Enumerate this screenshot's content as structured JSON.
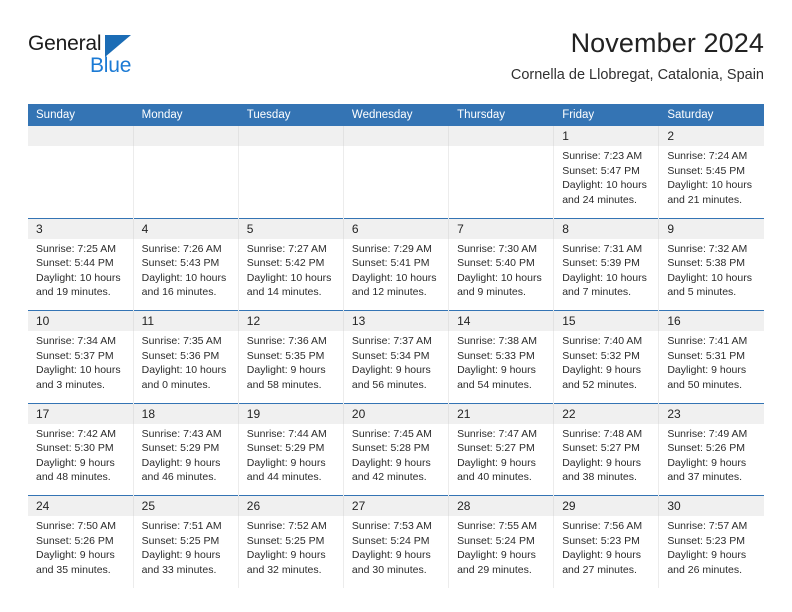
{
  "brand": {
    "name_part1": "General",
    "name_part2": "Blue",
    "accent_color": "#1B7AD4",
    "triangle_color": "#1B6CB5"
  },
  "header": {
    "title": "November 2024",
    "subtitle": "Cornella de Llobregat, Catalonia, Spain",
    "header_bg": "#3474B4"
  },
  "weekdays": [
    "Sunday",
    "Monday",
    "Tuesday",
    "Wednesday",
    "Thursday",
    "Friday",
    "Saturday"
  ],
  "labels": {
    "sunrise_prefix": "Sunrise: ",
    "sunset_prefix": "Sunset: ",
    "daylight_prefix": "Daylight: "
  },
  "weeks": [
    [
      {
        "day": "",
        "empty": true
      },
      {
        "day": "",
        "empty": true
      },
      {
        "day": "",
        "empty": true
      },
      {
        "day": "",
        "empty": true
      },
      {
        "day": "",
        "empty": true
      },
      {
        "day": "1",
        "sunrise": "Sunrise: 7:23 AM",
        "sunset": "Sunset: 5:47 PM",
        "daylight_l1": "Daylight: 10 hours",
        "daylight_l2": "and 24 minutes."
      },
      {
        "day": "2",
        "sunrise": "Sunrise: 7:24 AM",
        "sunset": "Sunset: 5:45 PM",
        "daylight_l1": "Daylight: 10 hours",
        "daylight_l2": "and 21 minutes."
      }
    ],
    [
      {
        "day": "3",
        "sunrise": "Sunrise: 7:25 AM",
        "sunset": "Sunset: 5:44 PM",
        "daylight_l1": "Daylight: 10 hours",
        "daylight_l2": "and 19 minutes."
      },
      {
        "day": "4",
        "sunrise": "Sunrise: 7:26 AM",
        "sunset": "Sunset: 5:43 PM",
        "daylight_l1": "Daylight: 10 hours",
        "daylight_l2": "and 16 minutes."
      },
      {
        "day": "5",
        "sunrise": "Sunrise: 7:27 AM",
        "sunset": "Sunset: 5:42 PM",
        "daylight_l1": "Daylight: 10 hours",
        "daylight_l2": "and 14 minutes."
      },
      {
        "day": "6",
        "sunrise": "Sunrise: 7:29 AM",
        "sunset": "Sunset: 5:41 PM",
        "daylight_l1": "Daylight: 10 hours",
        "daylight_l2": "and 12 minutes."
      },
      {
        "day": "7",
        "sunrise": "Sunrise: 7:30 AM",
        "sunset": "Sunset: 5:40 PM",
        "daylight_l1": "Daylight: 10 hours",
        "daylight_l2": "and 9 minutes."
      },
      {
        "day": "8",
        "sunrise": "Sunrise: 7:31 AM",
        "sunset": "Sunset: 5:39 PM",
        "daylight_l1": "Daylight: 10 hours",
        "daylight_l2": "and 7 minutes."
      },
      {
        "day": "9",
        "sunrise": "Sunrise: 7:32 AM",
        "sunset": "Sunset: 5:38 PM",
        "daylight_l1": "Daylight: 10 hours",
        "daylight_l2": "and 5 minutes."
      }
    ],
    [
      {
        "day": "10",
        "sunrise": "Sunrise: 7:34 AM",
        "sunset": "Sunset: 5:37 PM",
        "daylight_l1": "Daylight: 10 hours",
        "daylight_l2": "and 3 minutes."
      },
      {
        "day": "11",
        "sunrise": "Sunrise: 7:35 AM",
        "sunset": "Sunset: 5:36 PM",
        "daylight_l1": "Daylight: 10 hours",
        "daylight_l2": "and 0 minutes."
      },
      {
        "day": "12",
        "sunrise": "Sunrise: 7:36 AM",
        "sunset": "Sunset: 5:35 PM",
        "daylight_l1": "Daylight: 9 hours",
        "daylight_l2": "and 58 minutes."
      },
      {
        "day": "13",
        "sunrise": "Sunrise: 7:37 AM",
        "sunset": "Sunset: 5:34 PM",
        "daylight_l1": "Daylight: 9 hours",
        "daylight_l2": "and 56 minutes."
      },
      {
        "day": "14",
        "sunrise": "Sunrise: 7:38 AM",
        "sunset": "Sunset: 5:33 PM",
        "daylight_l1": "Daylight: 9 hours",
        "daylight_l2": "and 54 minutes."
      },
      {
        "day": "15",
        "sunrise": "Sunrise: 7:40 AM",
        "sunset": "Sunset: 5:32 PM",
        "daylight_l1": "Daylight: 9 hours",
        "daylight_l2": "and 52 minutes."
      },
      {
        "day": "16",
        "sunrise": "Sunrise: 7:41 AM",
        "sunset": "Sunset: 5:31 PM",
        "daylight_l1": "Daylight: 9 hours",
        "daylight_l2": "and 50 minutes."
      }
    ],
    [
      {
        "day": "17",
        "sunrise": "Sunrise: 7:42 AM",
        "sunset": "Sunset: 5:30 PM",
        "daylight_l1": "Daylight: 9 hours",
        "daylight_l2": "and 48 minutes."
      },
      {
        "day": "18",
        "sunrise": "Sunrise: 7:43 AM",
        "sunset": "Sunset: 5:29 PM",
        "daylight_l1": "Daylight: 9 hours",
        "daylight_l2": "and 46 minutes."
      },
      {
        "day": "19",
        "sunrise": "Sunrise: 7:44 AM",
        "sunset": "Sunset: 5:29 PM",
        "daylight_l1": "Daylight: 9 hours",
        "daylight_l2": "and 44 minutes."
      },
      {
        "day": "20",
        "sunrise": "Sunrise: 7:45 AM",
        "sunset": "Sunset: 5:28 PM",
        "daylight_l1": "Daylight: 9 hours",
        "daylight_l2": "and 42 minutes."
      },
      {
        "day": "21",
        "sunrise": "Sunrise: 7:47 AM",
        "sunset": "Sunset: 5:27 PM",
        "daylight_l1": "Daylight: 9 hours",
        "daylight_l2": "and 40 minutes."
      },
      {
        "day": "22",
        "sunrise": "Sunrise: 7:48 AM",
        "sunset": "Sunset: 5:27 PM",
        "daylight_l1": "Daylight: 9 hours",
        "daylight_l2": "and 38 minutes."
      },
      {
        "day": "23",
        "sunrise": "Sunrise: 7:49 AM",
        "sunset": "Sunset: 5:26 PM",
        "daylight_l1": "Daylight: 9 hours",
        "daylight_l2": "and 37 minutes."
      }
    ],
    [
      {
        "day": "24",
        "sunrise": "Sunrise: 7:50 AM",
        "sunset": "Sunset: 5:26 PM",
        "daylight_l1": "Daylight: 9 hours",
        "daylight_l2": "and 35 minutes."
      },
      {
        "day": "25",
        "sunrise": "Sunrise: 7:51 AM",
        "sunset": "Sunset: 5:25 PM",
        "daylight_l1": "Daylight: 9 hours",
        "daylight_l2": "and 33 minutes."
      },
      {
        "day": "26",
        "sunrise": "Sunrise: 7:52 AM",
        "sunset": "Sunset: 5:25 PM",
        "daylight_l1": "Daylight: 9 hours",
        "daylight_l2": "and 32 minutes."
      },
      {
        "day": "27",
        "sunrise": "Sunrise: 7:53 AM",
        "sunset": "Sunset: 5:24 PM",
        "daylight_l1": "Daylight: 9 hours",
        "daylight_l2": "and 30 minutes."
      },
      {
        "day": "28",
        "sunrise": "Sunrise: 7:55 AM",
        "sunset": "Sunset: 5:24 PM",
        "daylight_l1": "Daylight: 9 hours",
        "daylight_l2": "and 29 minutes."
      },
      {
        "day": "29",
        "sunrise": "Sunrise: 7:56 AM",
        "sunset": "Sunset: 5:23 PM",
        "daylight_l1": "Daylight: 9 hours",
        "daylight_l2": "and 27 minutes."
      },
      {
        "day": "30",
        "sunrise": "Sunrise: 7:57 AM",
        "sunset": "Sunset: 5:23 PM",
        "daylight_l1": "Daylight: 9 hours",
        "daylight_l2": "and 26 minutes."
      }
    ]
  ]
}
